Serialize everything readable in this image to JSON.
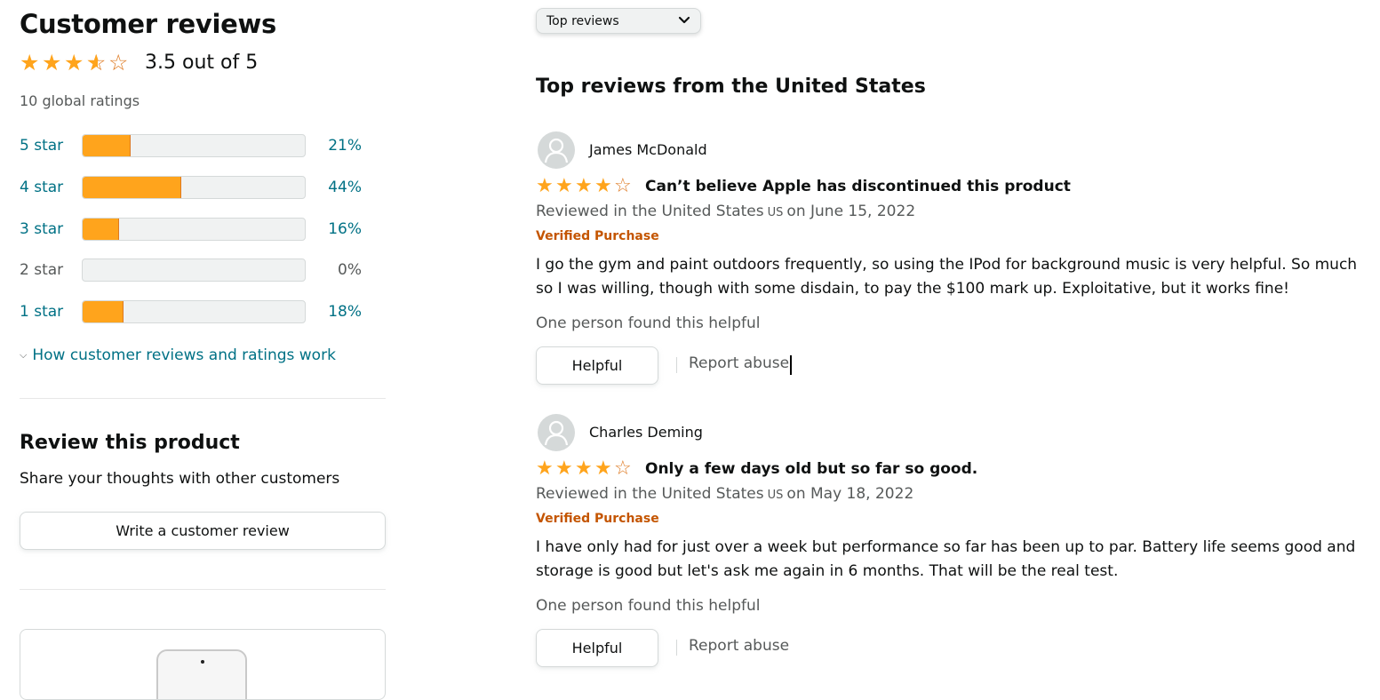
{
  "summary": {
    "title": "Customer reviews",
    "rating": 3.5,
    "rating_text": "3.5 out of 5",
    "global_ratings": "10 global ratings",
    "histogram": [
      {
        "label": "5 star",
        "percent_text": "21%",
        "percent": 21,
        "enabled": true
      },
      {
        "label": "4 star",
        "percent_text": "44%",
        "percent": 44,
        "enabled": true
      },
      {
        "label": "3 star",
        "percent_text": "16%",
        "percent": 16,
        "enabled": true
      },
      {
        "label": "2 star",
        "percent_text": "0%",
        "percent": 0,
        "enabled": false
      },
      {
        "label": "1 star",
        "percent_text": "18%",
        "percent": 18,
        "enabled": true
      }
    ],
    "how_link": "How customer reviews and ratings work"
  },
  "review_product": {
    "title": "Review this product",
    "subtitle": "Share your thoughts with other customers",
    "button": "Write a customer review"
  },
  "sort": {
    "selected": "Top reviews"
  },
  "reviews_section": {
    "title": "Top reviews from the United States"
  },
  "reviews": [
    {
      "author": "James McDonald",
      "rating": 4,
      "title": "Can’t believe Apple has discontinued this product",
      "date_prefix": "Reviewed in the United States",
      "country_code": "US",
      "date_suffix": "on June 15, 2022",
      "verified": "Verified Purchase",
      "body": "I go the gym and paint outdoors frequently, so using the IPod for background music is very helpful. So much so I was willing, though with some disdain, to pay the $100 mark up. Exploitative, but it works fine!",
      "helpful_count": "One person found this helpful",
      "helpful_button": "Helpful",
      "report": "Report abuse"
    },
    {
      "author": "Charles Deming",
      "rating": 4,
      "title": "Only a few days old but so far so good.",
      "date_prefix": "Reviewed in the United States",
      "country_code": "US",
      "date_suffix": "on May 18, 2022",
      "verified": "Verified Purchase",
      "body": "I have only had for just over a week but performance so far has been up to par. Battery life seems good and storage is good but let's ask me again in 6 months. That will be the real test.",
      "helpful_count": "One person found this helpful",
      "helpful_button": "Helpful",
      "report": "Report abuse"
    }
  ],
  "colors": {
    "star": "#ffa41c",
    "link": "#007185",
    "verified": "#c45500",
    "muted": "#565959"
  }
}
